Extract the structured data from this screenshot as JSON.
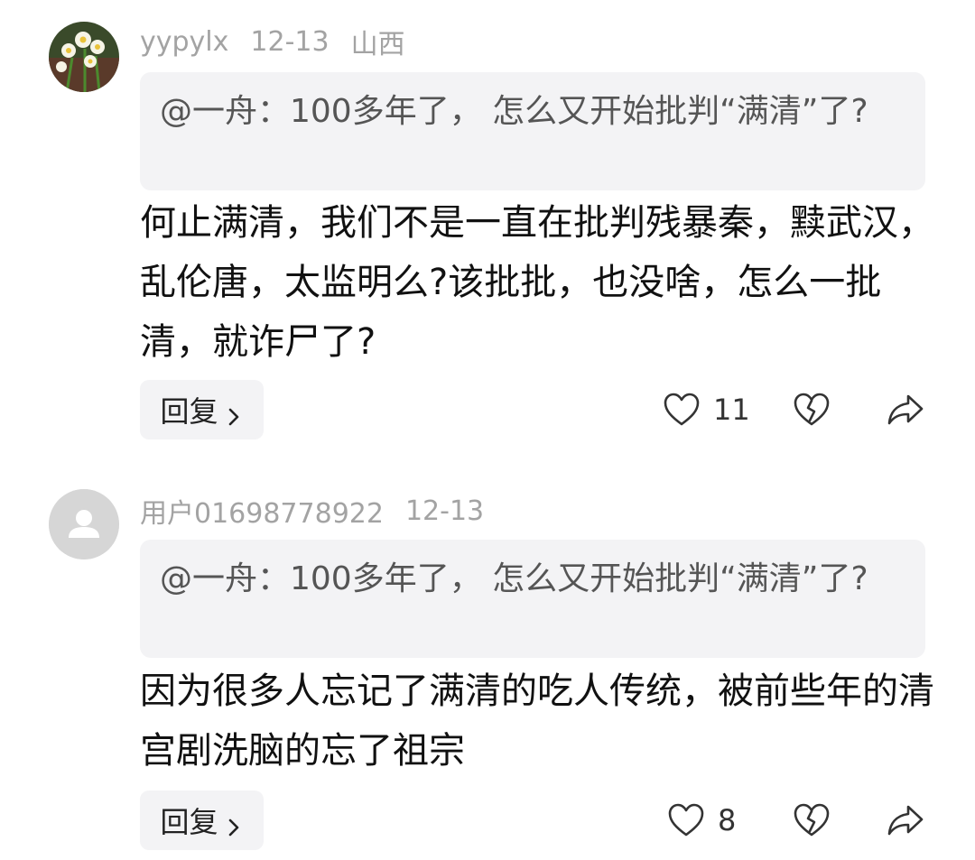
{
  "comments": [
    {
      "username": "yypylx",
      "date": "12-13",
      "location": "山西",
      "avatar_icon": "narcissus-flower-photo",
      "quote": "@一舟：100多年了， 怎么又开始批判“满清”了?",
      "text": "何止满清，我们不是一直在批判残暴秦，黩武汉，乱伦唐，太监明么?该批批，也没啥，怎么一批清，就诈尸了?",
      "reply_label": "回复",
      "likes": "11"
    },
    {
      "username": "用户01698778922",
      "date": "12-13",
      "location": "",
      "avatar_icon": "default-user-avatar-icon",
      "quote": "@一舟：100多年了， 怎么又开始批判“满清”了?",
      "text": "因为很多人忘记了满清的吃人传统，被前些年的清宫剧洗脑的忘了祖宗",
      "reply_label": "回复",
      "likes": "8"
    }
  ],
  "icons": {
    "like": "heart-outline-icon",
    "dislike": "broken-heart-icon",
    "share": "share-arrow-icon",
    "reply_chevron": "chevron-right-icon"
  },
  "colors": {
    "meta_text": "#a3a3a3",
    "quote_bg": "#f3f3f5",
    "quote_text": "#555555",
    "body_text": "#111111"
  }
}
